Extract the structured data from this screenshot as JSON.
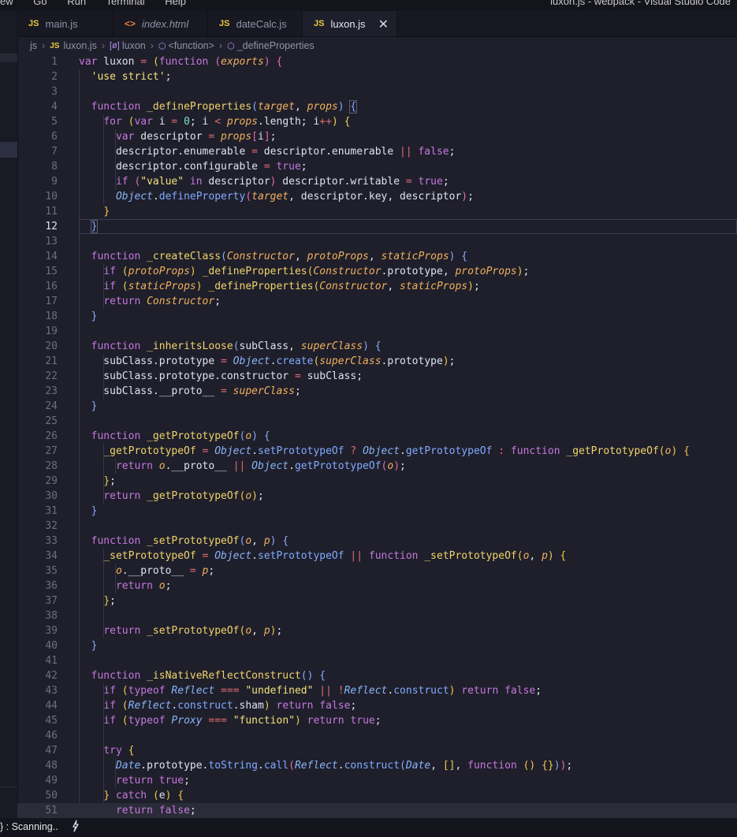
{
  "window": {
    "menu": [
      "ew",
      "Go",
      "Run",
      "Terminal",
      "Help"
    ],
    "title": "luxon.js - webpack - Visual Studio Code"
  },
  "tabs": [
    {
      "label": "main.js",
      "icon": "js-file-icon",
      "icon_text": "JS"
    },
    {
      "label": "index.html",
      "icon": "html-file-icon",
      "icon_text": "<>"
    },
    {
      "label": "dateCalc.js",
      "icon": "js-file-icon",
      "icon_text": "JS"
    },
    {
      "label": "luxon.js",
      "icon": "js-file-icon",
      "icon_text": "JS",
      "active": true,
      "close": "✕"
    }
  ],
  "breadcrumb": {
    "folder": "js",
    "file_icon": "JS",
    "file": "luxon.js",
    "var_icon": "[ø]",
    "var": "luxon",
    "fn_icon": "⬡",
    "fn": "<function>",
    "method_icon": "⬡",
    "method": "_defineProperties"
  },
  "editor": {
    "language": "JavaScript",
    "cursor_line": 12,
    "line_numbers": [
      "1",
      "2",
      "3",
      "4",
      "5",
      "6",
      "7",
      "8",
      "9",
      "10",
      "11",
      "12",
      "13",
      "14",
      "15",
      "16",
      "17",
      "18",
      "19",
      "20",
      "21",
      "22",
      "23",
      "24",
      "25",
      "26",
      "27",
      "28",
      "29",
      "30",
      "31",
      "32",
      "33",
      "34",
      "35",
      "36",
      "37",
      "38",
      "39",
      "40",
      "41",
      "42",
      "43",
      "44",
      "45",
      "46",
      "47",
      "48",
      "49",
      "50",
      "51"
    ]
  },
  "statusbar": {
    "scanning": "} : Scanning..",
    "plug_icon": "plug-icon"
  },
  "colors": {
    "background": "#1e1f2b",
    "keyword": "#c678dd",
    "function": "#f3d36b",
    "parameter": "#f2b05e",
    "type": "#8ab4f8",
    "string": "#f4e27a",
    "number": "#7ee1c2"
  }
}
